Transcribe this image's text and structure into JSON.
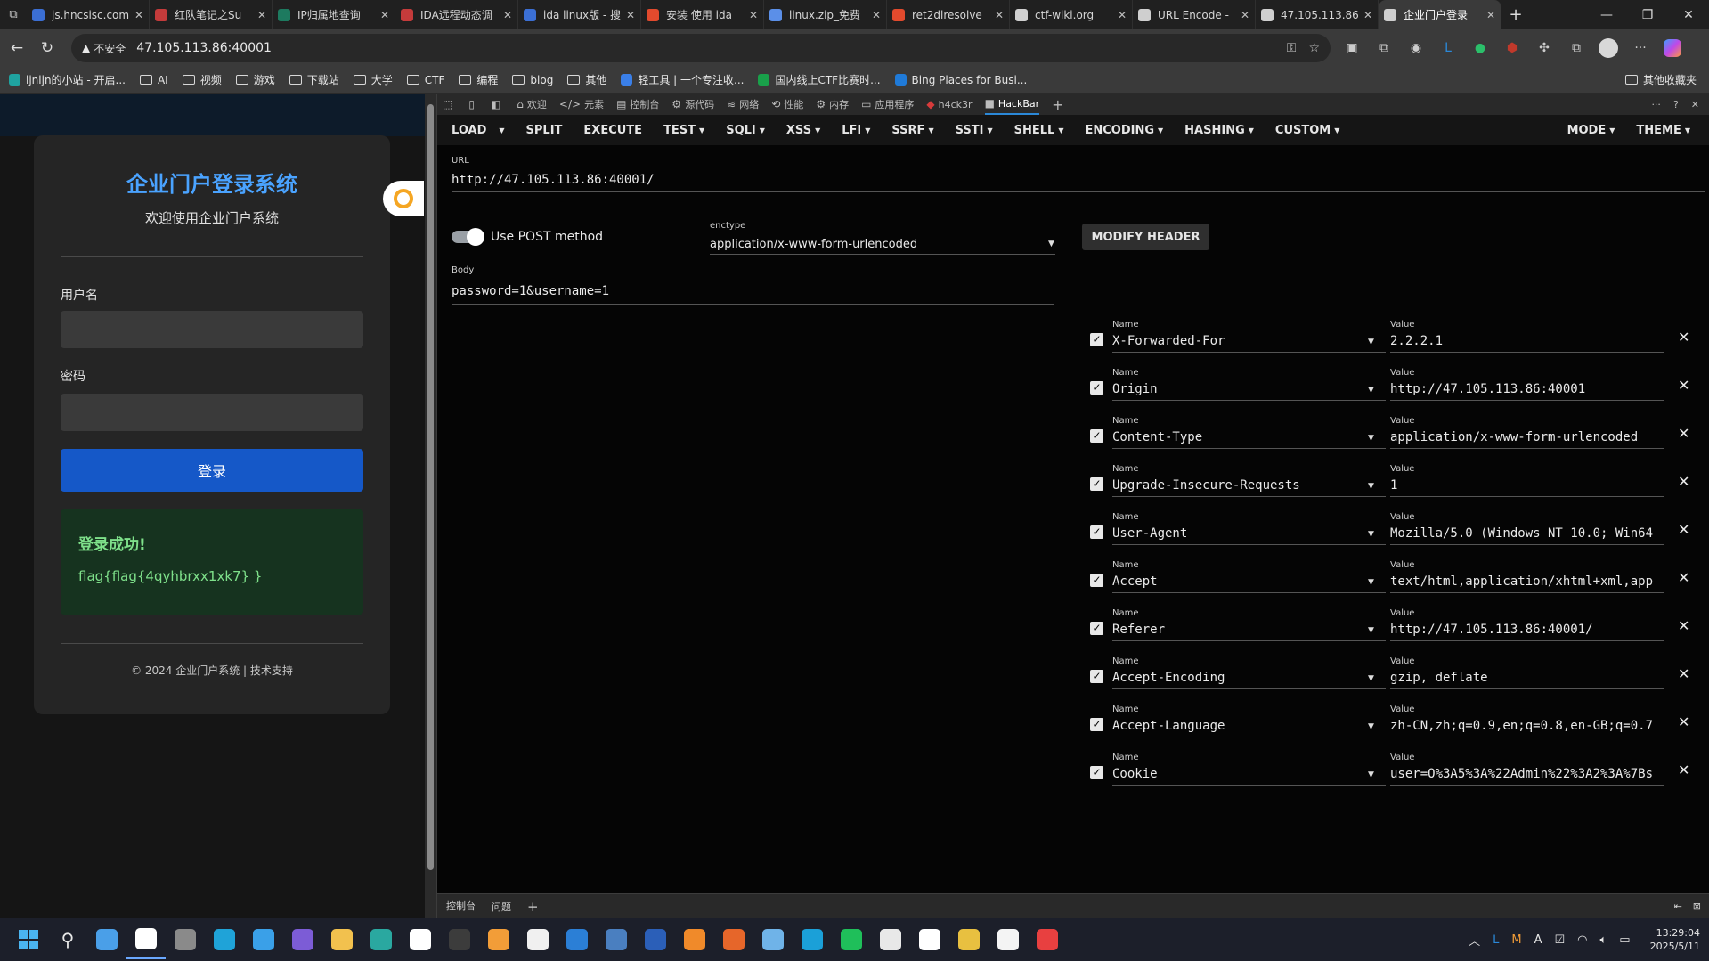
{
  "browser": {
    "tabs": [
      {
        "title": "js.hncsisc.com",
        "color": "#3b6fd4"
      },
      {
        "title": "红队笔记之Su",
        "color": "#c43b3b"
      },
      {
        "title": "IP归属地查询",
        "color": "#1d7a5f"
      },
      {
        "title": "IDA远程动态调",
        "color": "#c43b3b"
      },
      {
        "title": "ida linux版 - 搜",
        "color": "#3b6fd4"
      },
      {
        "title": "安装 使用 ida",
        "color": "#e24a2d"
      },
      {
        "title": "linux.zip_免费",
        "color": "#5b8fe8"
      },
      {
        "title": "ret2dlresolve",
        "color": "#e24a2d"
      },
      {
        "title": "ctf-wiki.org",
        "color": "#cfcfcf"
      },
      {
        "title": "URL Encode -",
        "color": "#cfcfcf"
      },
      {
        "title": "47.105.113.86",
        "color": "#cfcfcf"
      },
      {
        "title": "企业门户登录",
        "color": "#cfcfcf"
      }
    ],
    "address": {
      "insecure_label": "不安全",
      "url": "47.105.113.86:40001"
    },
    "bookmarks": [
      "ljnljn的小站 - 开启...",
      "AI",
      "视频",
      "游戏",
      "下载站",
      "大学",
      "CTF",
      "编程",
      "blog",
      "其他",
      "轻工具 | 一个专注收...",
      "国内线上CTF比赛时...",
      "Bing Places for Busi..."
    ],
    "other_bookmarks": "其他收藏夹"
  },
  "page": {
    "title": "企业门户登录系统",
    "subtitle": "欢迎使用企业门户系统",
    "username_label": "用户名",
    "password_label": "密码",
    "login_button": "登录",
    "success_heading": "登录成功!",
    "flag": "flag{flag{4qyhbrxx1xk7} }",
    "footer": "© 2024 企业门户系统 | 技术支持"
  },
  "devtools": {
    "tabs": [
      "欢迎",
      "元素",
      "控制台",
      "源代码",
      "网络",
      "性能",
      "内存",
      "应用程序",
      "h4ck3r",
      "HackBar"
    ],
    "drawer_tabs": [
      "控制台",
      "问题"
    ]
  },
  "hackbar": {
    "menu": [
      "LOAD",
      "SPLIT",
      "EXECUTE",
      "TEST",
      "SQLI",
      "XSS",
      "LFI",
      "SSRF",
      "SSTI",
      "SHELL",
      "ENCODING",
      "HASHING",
      "CUSTOM"
    ],
    "menu_right": [
      "MODE",
      "THEME"
    ],
    "url_label": "URL",
    "url": "http://47.105.113.86:40001/",
    "post_label": "Use POST method",
    "enctype_label": "enctype",
    "enctype": "application/x-www-form-urlencoded",
    "modify_header": "MODIFY HEADER",
    "body_label": "Body",
    "body": "password=1&username=1",
    "name_label": "Name",
    "value_label": "Value",
    "headers": [
      {
        "name": "X-Forwarded-For",
        "value": "2.2.2.1"
      },
      {
        "name": "Origin",
        "value": "http://47.105.113.86:40001"
      },
      {
        "name": "Content-Type",
        "value": "application/x-www-form-urlencoded"
      },
      {
        "name": "Upgrade-Insecure-Requests",
        "value": "1"
      },
      {
        "name": "User-Agent",
        "value": "Mozilla/5.0 (Windows NT 10.0; Win64"
      },
      {
        "name": "Accept",
        "value": "text/html,application/xhtml+xml,app"
      },
      {
        "name": "Referer",
        "value": "http://47.105.113.86:40001/"
      },
      {
        "name": "Accept-Encoding",
        "value": "gzip, deflate"
      },
      {
        "name": "Accept-Language",
        "value": "zh-CN,zh;q=0.9,en;q=0.8,en-GB;q=0.7"
      },
      {
        "name": "Cookie",
        "value": "user=O%3A5%3A%22Admin%22%3A2%3A%7Bs"
      }
    ]
  },
  "taskbar": {
    "apps": [
      "#4a9fe8",
      "#ffffff",
      "#8a8a8a",
      "#1fa3d8",
      "#3aa0e8",
      "#7c5cd6",
      "#f2c14e",
      "#2aa8a0",
      "#ffffff",
      "#3c3c3c",
      "#f29d38",
      "#f0f0f0",
      "#2b7fd6",
      "#4a7fc0",
      "#2b5fb8",
      "#f08a2a",
      "#e6662a",
      "#6fb3e8",
      "#1ba0d8",
      "#1fbf5a",
      "#e8e8e8",
      "#ffffff",
      "#e8c040",
      "#f4f4f4",
      "#e84040"
    ],
    "time": "13:29:04",
    "date": "2025/5/11"
  }
}
